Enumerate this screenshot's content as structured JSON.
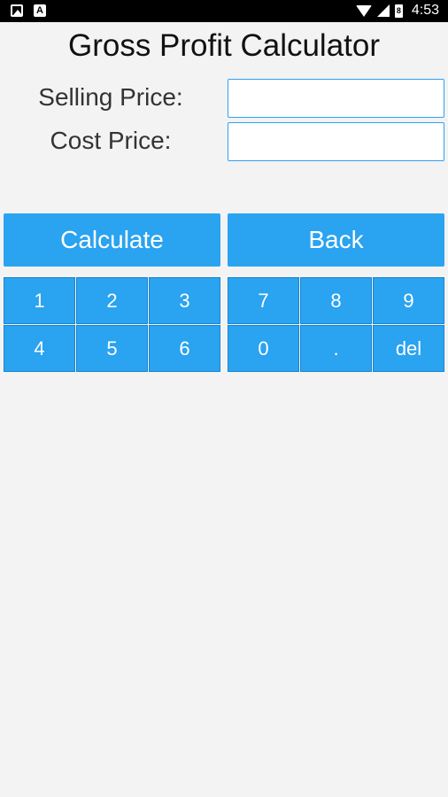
{
  "status_bar": {
    "time": "4:53",
    "battery_label": "8"
  },
  "title": "Gross Profit Calculator",
  "form": {
    "selling_label": "Selling Price:",
    "cost_label": "Cost Price:",
    "selling_value": "",
    "cost_value": ""
  },
  "buttons": {
    "calculate": "Calculate",
    "back": "Back"
  },
  "keypad_left": [
    "1",
    "2",
    "3",
    "4",
    "5",
    "6"
  ],
  "keypad_right": [
    "7",
    "8",
    "9",
    "0",
    ".",
    "del"
  ],
  "colors": {
    "accent": "#2aa3f0",
    "background": "#f3f3f3"
  }
}
